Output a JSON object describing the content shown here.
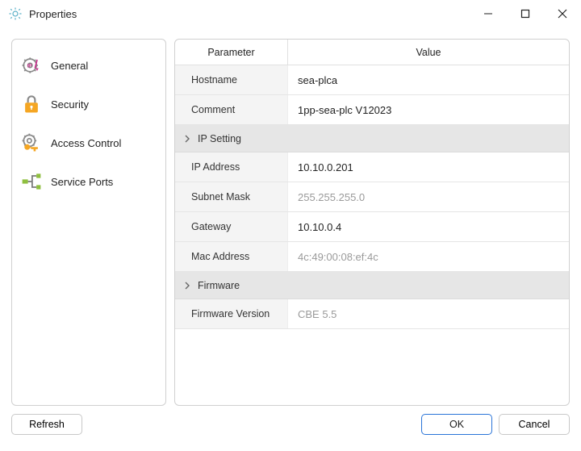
{
  "window": {
    "title": "Properties"
  },
  "sidebar": {
    "items": [
      {
        "label": "General"
      },
      {
        "label": "Security"
      },
      {
        "label": "Access Control"
      },
      {
        "label": "Service Ports"
      }
    ]
  },
  "grid": {
    "headers": {
      "param": "Parameter",
      "value": "Value"
    },
    "rows": [
      {
        "param": "Hostname",
        "value": "sea-plca",
        "muted": false
      },
      {
        "param": "Comment",
        "value": "1pp-sea-plc V12023",
        "muted": false
      }
    ],
    "sections": [
      {
        "title": "IP Setting",
        "rows": [
          {
            "param": "IP Address",
            "value": "10.10.0.201",
            "muted": false
          },
          {
            "param": "Subnet Mask",
            "value": "255.255.255.0",
            "muted": true
          },
          {
            "param": "Gateway",
            "value": "10.10.0.4",
            "muted": false
          },
          {
            "param": "Mac Address",
            "value": "4c:49:00:08:ef:4c",
            "muted": true
          }
        ]
      },
      {
        "title": "Firmware",
        "rows": [
          {
            "param": "Firmware Version",
            "value": "CBE 5.5",
            "muted": true
          }
        ]
      }
    ]
  },
  "footer": {
    "refresh": "Refresh",
    "ok": "OK",
    "cancel": "Cancel"
  }
}
